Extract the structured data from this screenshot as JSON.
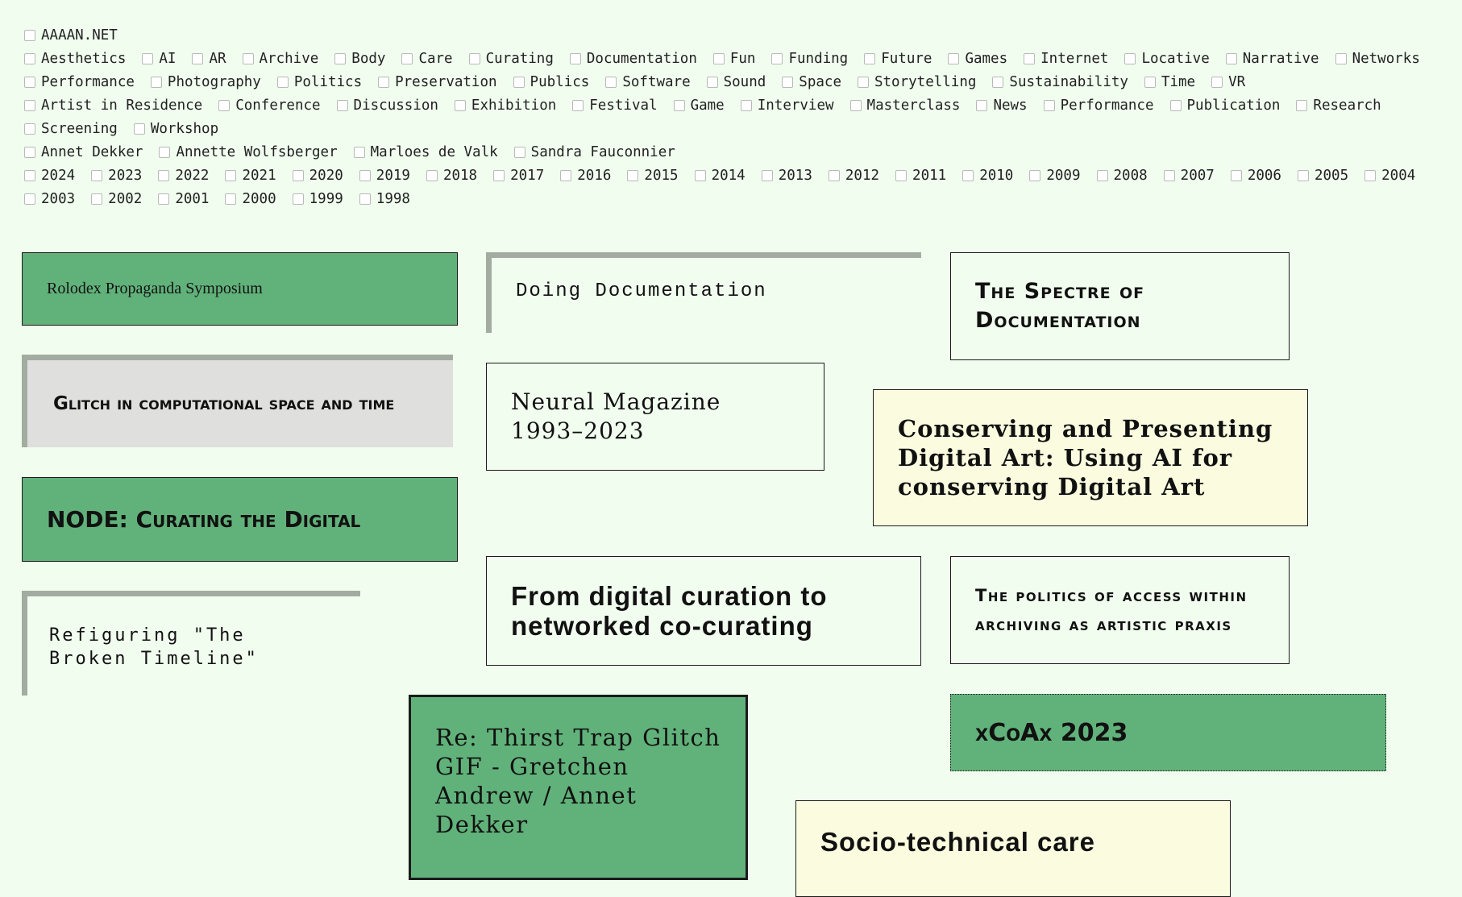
{
  "site": {
    "title": "AAAAN.NET"
  },
  "filters": {
    "topics": [
      "Aesthetics",
      "AI",
      "AR",
      "Archive",
      "Body",
      "Care",
      "Curating",
      "Documentation",
      "Fun",
      "Funding",
      "Future",
      "Games",
      "Internet",
      "Locative",
      "Narrative",
      "Networks",
      "Performance",
      "Photography",
      "Politics",
      "Preservation",
      "Publics",
      "Software",
      "Sound",
      "Space",
      "Storytelling",
      "Sustainability",
      "Time",
      "VR"
    ],
    "types": [
      "Artist in Residence",
      "Conference",
      "Discussion",
      "Exhibition",
      "Festival",
      "Game",
      "Interview",
      "Masterclass",
      "News",
      "Performance",
      "Publication",
      "Research",
      "Screening",
      "Workshop"
    ],
    "people": [
      "Annet Dekker",
      "Annette Wolfsberger",
      "Marloes de Valk",
      "Sandra Fauconnier"
    ],
    "years": [
      "2024",
      "2023",
      "2022",
      "2021",
      "2020",
      "2019",
      "2018",
      "2017",
      "2016",
      "2015",
      "2014",
      "2013",
      "2012",
      "2011",
      "2010",
      "2009",
      "2008",
      "2007",
      "2006",
      "2005",
      "2004",
      "2003",
      "2002",
      "2001",
      "2000",
      "1999",
      "1998"
    ]
  },
  "cards": [
    {
      "title": "Rolodex Propaganda Symposium"
    },
    {
      "title": "Doing Documentation"
    },
    {
      "title": "The Spectre of Documentation"
    },
    {
      "title": "Glitch in computational space and time"
    },
    {
      "title": "Neural Magazine 1993–2023"
    },
    {
      "title": "Conserving and Presenting Digital Art: Using AI for conserving Digital Art"
    },
    {
      "title": "NODE: Curating the Digital"
    },
    {
      "title": "From digital curation to networked co-curating"
    },
    {
      "title": "The politics of access within archiving as artistic praxis"
    },
    {
      "title": "Refiguring \"The Broken Timeline\""
    },
    {
      "title": "xCoAx 2023"
    },
    {
      "title": "Re: Thirst Trap Glitch GIF - Gretchen Andrew / Annet Dekker"
    },
    {
      "title": "Socio-technical care"
    }
  ]
}
